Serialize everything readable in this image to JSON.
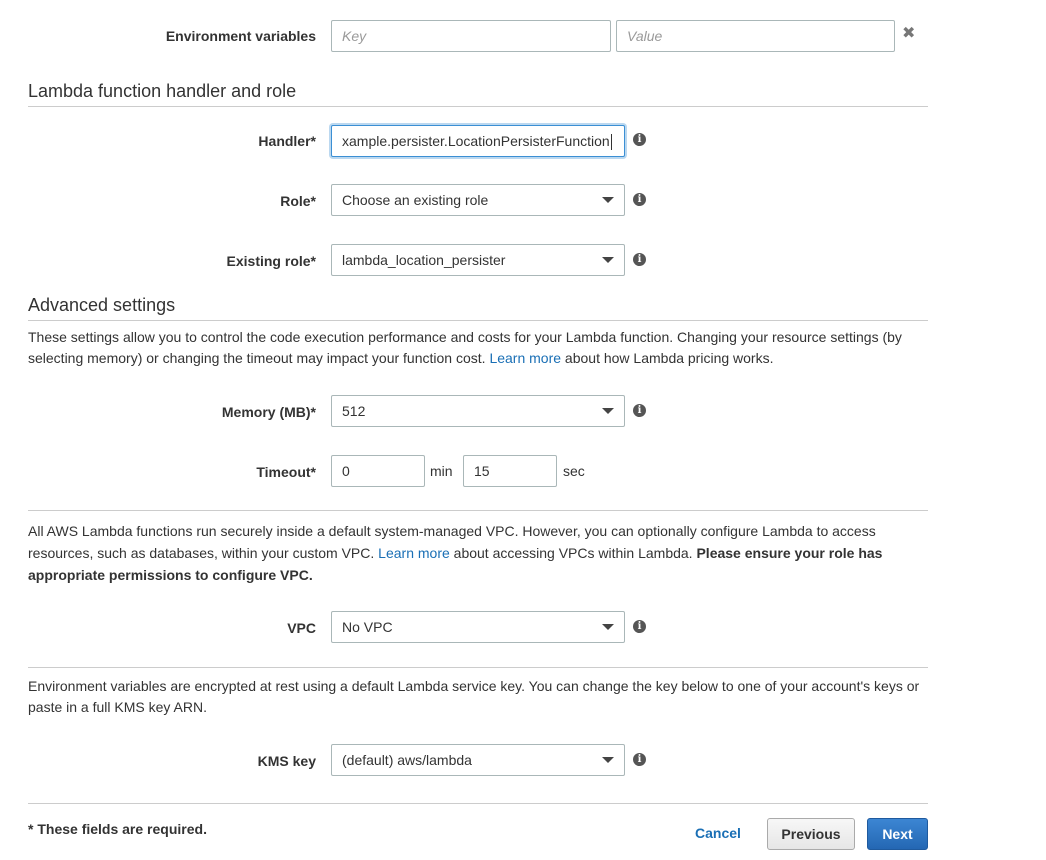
{
  "env_vars": {
    "label": "Environment variables",
    "key_placeholder": "Key",
    "value_placeholder": "Value",
    "remove_glyph": "✖"
  },
  "handler_section": {
    "title": "Lambda function handler and role",
    "handler_label": "Handler*",
    "handler_value": "xample.persister.LocationPersisterFunction",
    "role_label": "Role*",
    "role_value": "Choose an existing role",
    "existing_role_label": "Existing role*",
    "existing_role_value": "lambda_location_persister"
  },
  "advanced": {
    "title": "Advanced settings",
    "desc_part1": "These settings allow you to control the code execution performance and costs for your Lambda function. Changing your resource settings (by selecting memory) or changing the timeout may impact your function cost. ",
    "desc_link": "Learn more",
    "desc_part2": " about how Lambda pricing works.",
    "memory_label": "Memory (MB)*",
    "memory_value": "512",
    "timeout_label": "Timeout*",
    "timeout_min_value": "0",
    "timeout_min_unit": "min",
    "timeout_sec_value": "15",
    "timeout_sec_unit": "sec"
  },
  "vpc": {
    "desc_part1": "All AWS Lambda functions run securely inside a default system-managed VPC. However, you can optionally configure Lambda to access resources, such as databases, within your custom VPC. ",
    "desc_link": "Learn more",
    "desc_part2": " about accessing VPCs within Lambda. ",
    "desc_bold": "Please ensure your role has appropriate permissions to configure VPC.",
    "label": "VPC",
    "value": "No VPC"
  },
  "kms": {
    "desc": "Environment variables are encrypted at rest using a default Lambda service key. You can change the key below to one of your account's keys or paste in a full KMS key ARN.",
    "label": "KMS key",
    "value": "(default) aws/lambda"
  },
  "footer": {
    "required_note": "* These fields are required.",
    "cancel_label": "Cancel",
    "previous_label": "Previous",
    "next_label": "Next"
  },
  "icons": {
    "info_glyph": "i"
  },
  "colors": {
    "link": "#1a6fb5",
    "primary_button": "#2467b3"
  }
}
